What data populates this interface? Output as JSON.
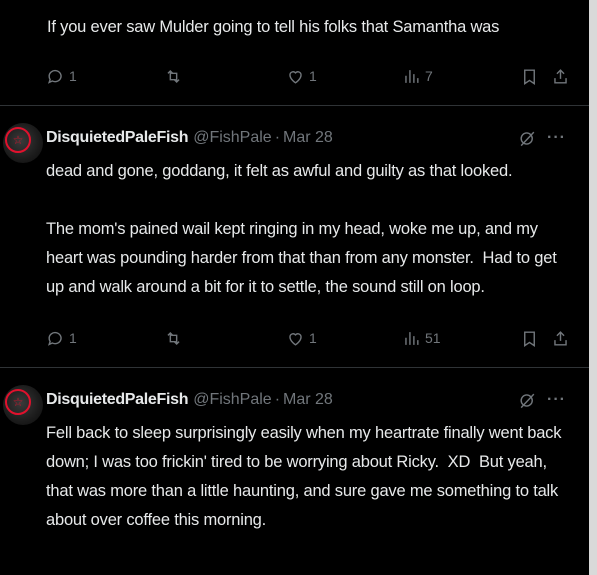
{
  "posts": [
    {
      "text": "If you ever saw Mulder going to tell his folks that Samantha was",
      "replies": "1",
      "retweets": "",
      "likes": "1",
      "views": "7"
    },
    {
      "author_name": "DisquietedPaleFish",
      "handle": "@FishPale",
      "dot": "·",
      "date": "Mar 28",
      "text": "dead and gone, goddаng, it felt as awful and guilty as that looked.\n\nThe mom's pained wail kept ringing in my head, woke me up, and my heart was pounding harder from that than from any monster.  Had to get up and walk around a bit for it to settle, the sound still on loop.",
      "replies": "1",
      "retweets": "",
      "likes": "1",
      "views": "51"
    },
    {
      "author_name": "DisquietedPaleFish",
      "handle": "@FishPale",
      "dot": "·",
      "date": "Mar 28",
      "text": "Fell back to sleep surprisingly easily when my heartrate finally went back down; I was too frickin' tired to be worrying about Ricky.  XD  But yeah, that was more than a little haunting, and sure gave me something to talk about over coffee this morning."
    }
  ],
  "icons": {
    "reply": "reply-icon",
    "retweet": "retweet-icon",
    "like": "heart-icon",
    "views": "views-icon",
    "bookmark": "bookmark-icon",
    "share": "share-icon",
    "grok": "grok-icon",
    "more": "more-icon"
  },
  "colors": {
    "background": "#000000",
    "text": "#e7e9ea",
    "muted": "#71767b",
    "divider": "#2f3336",
    "avatar_accent": "#e0112d"
  }
}
